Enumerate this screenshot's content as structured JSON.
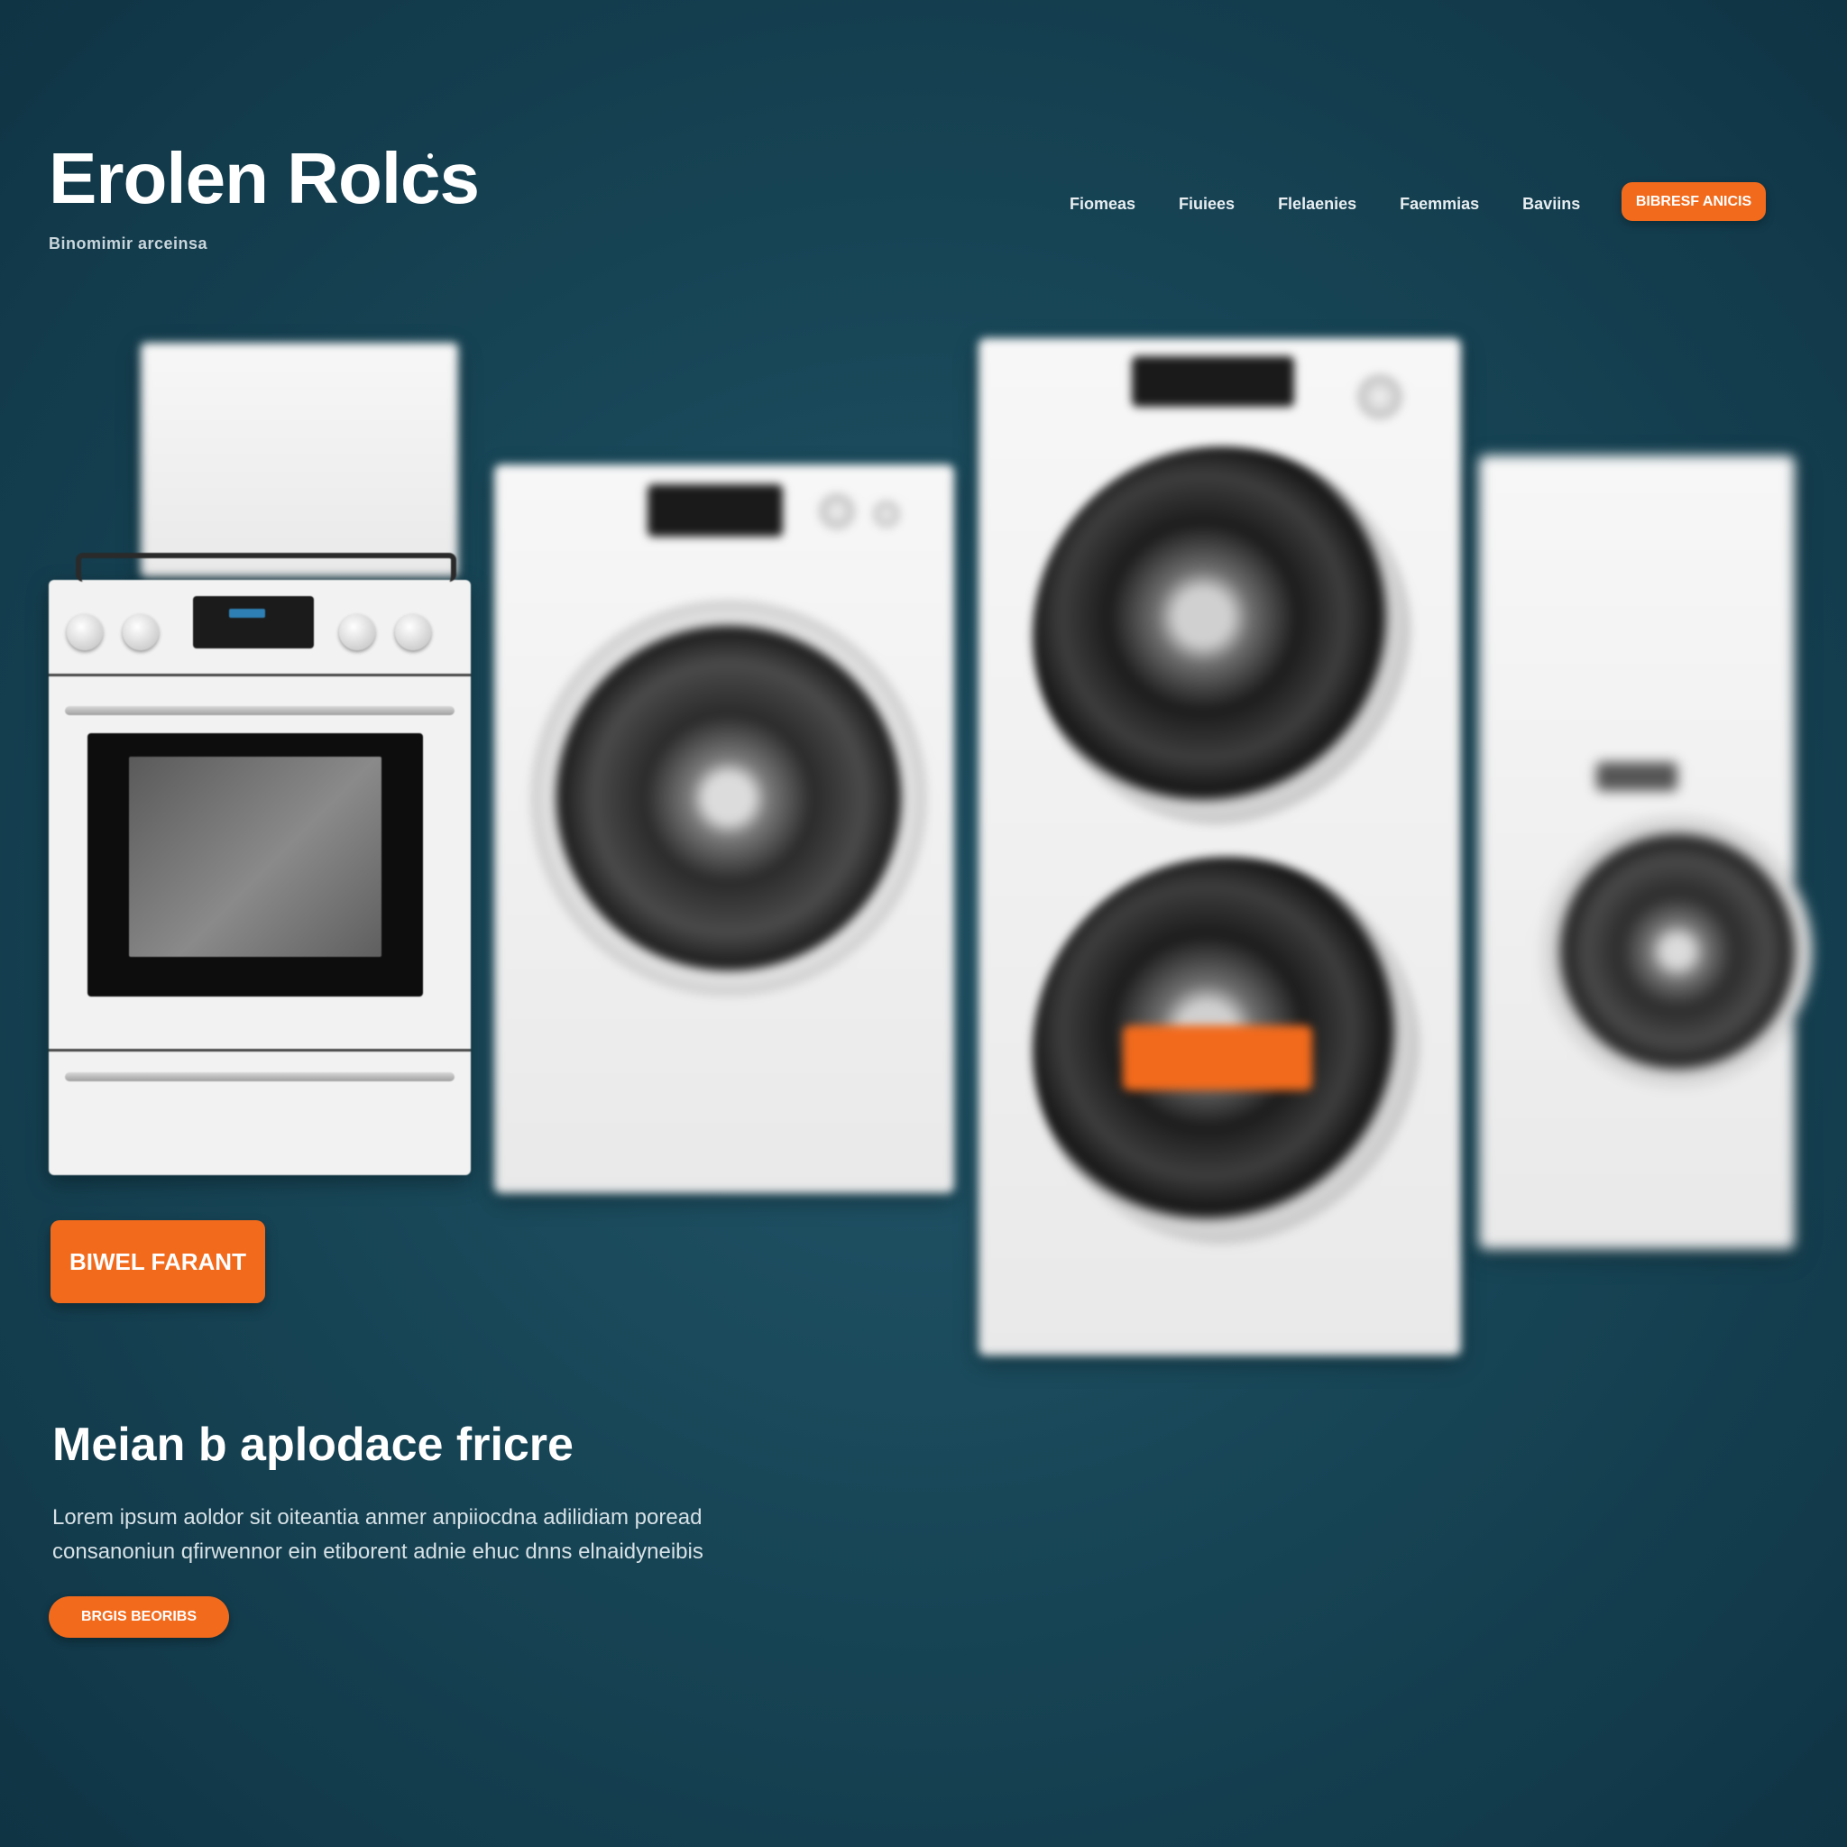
{
  "header": {
    "brand_title": "Erolen Rolcs",
    "brand_tagline": "Binomimir arceinsa",
    "nav": [
      "Fiomeas",
      "Fiuiees",
      "Flelaenies",
      "Faemmias",
      "Baviins"
    ],
    "cta_label": "BIBRESF ANICIS"
  },
  "hero": {
    "primary_button": "BIWEL FARANT",
    "heading": "Meian b aplodace fricre",
    "body_line_1": "Lorem ipsum aoldor sit oiteantia anmer anpiiocdna adilidiam poread",
    "body_line_2": "consanoniun qfirwennor ein etiborent adnie ehuc dnns elnaidyneibis",
    "secondary_button": "BRGIS BEORIBS"
  },
  "colors": {
    "background": "#184758",
    "accent": "#f26a1c",
    "text": "#ffffff"
  }
}
